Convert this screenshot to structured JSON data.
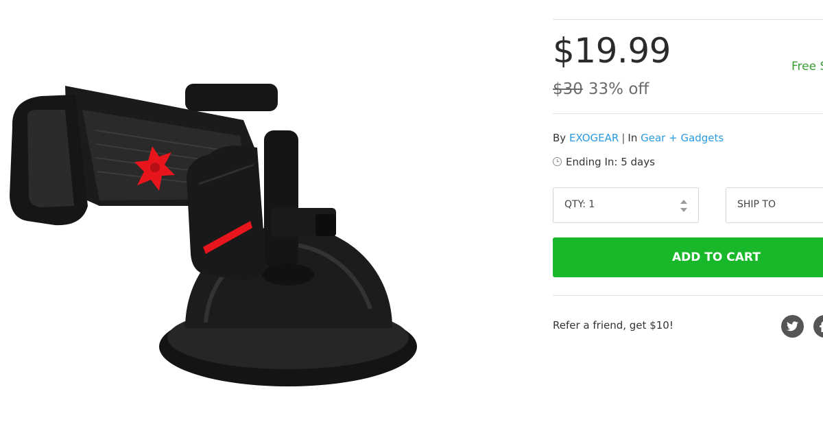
{
  "product": {
    "image_subject": "black suction-cup car phone mount with red accents",
    "price": "$19.99",
    "original_price": "$30",
    "discount": "33% off",
    "shipping": "Free S"
  },
  "meta": {
    "by_label": "By",
    "brand": "EXOGEAR",
    "separator": "|",
    "in_label": "In",
    "category": "Gear + Gadgets",
    "ending": "Ending In: 5 days"
  },
  "purchase": {
    "qty_label": "QTY: 1",
    "ship_label": "SHIP TO",
    "add_to_cart": "ADD TO CART"
  },
  "share": {
    "refer_text": "Refer a friend, get $10!",
    "icons": [
      "twitter-icon",
      "facebook-icon"
    ]
  },
  "colors": {
    "accent_green": "#19b82b",
    "link_blue": "#2a9be3",
    "free_ship_green": "#3a9c35",
    "mount_red": "#e8151c"
  }
}
